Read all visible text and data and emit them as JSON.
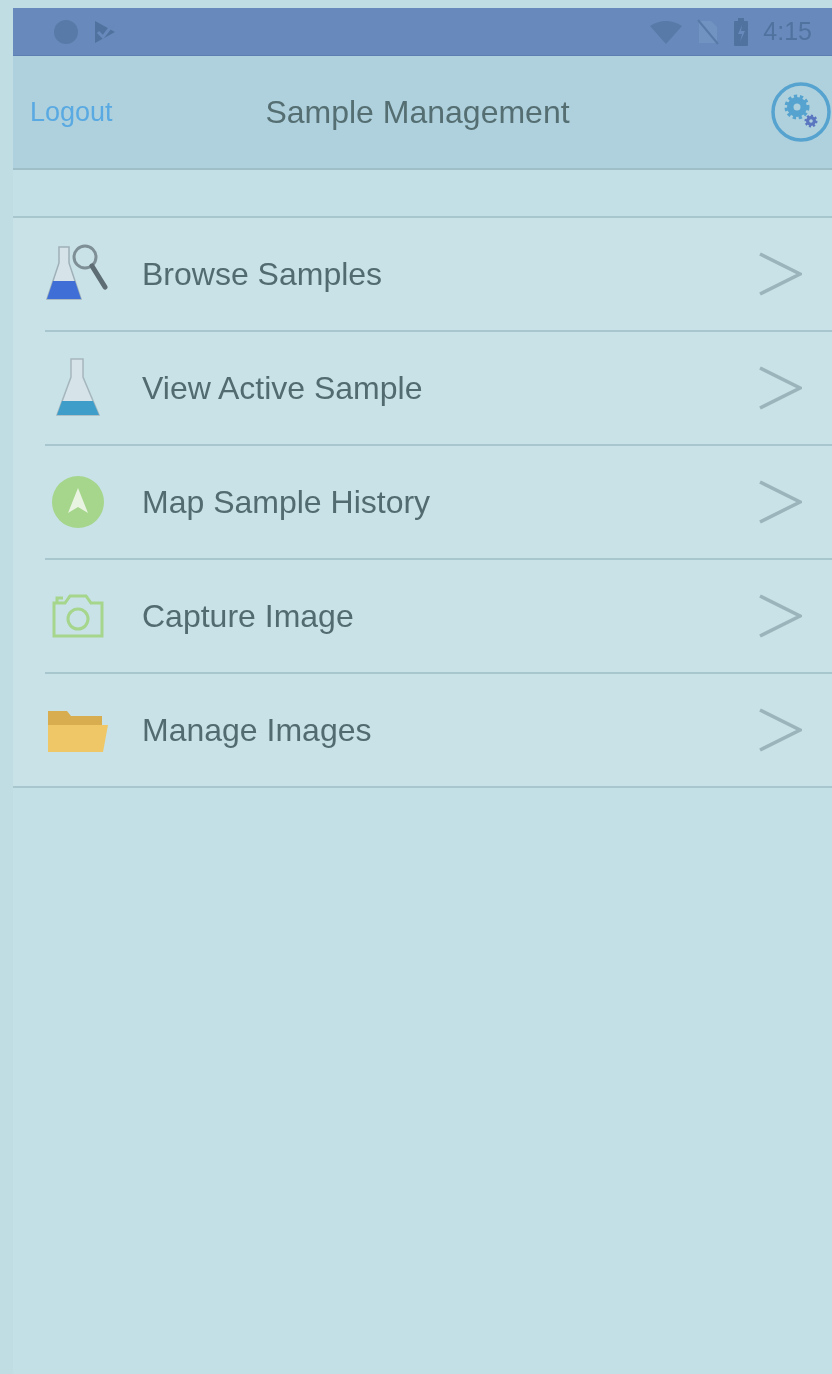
{
  "status_bar": {
    "time": "4:15"
  },
  "header": {
    "logout": "Logout",
    "title": "Sample Management"
  },
  "menu": [
    {
      "kind": "browse",
      "label": "Browse Samples"
    },
    {
      "kind": "flask",
      "label": "View Active Sample"
    },
    {
      "kind": "navigate",
      "label": "Map Sample History"
    },
    {
      "kind": "camera",
      "label": "Capture Image"
    },
    {
      "kind": "folder",
      "label": "Manage Images"
    }
  ]
}
